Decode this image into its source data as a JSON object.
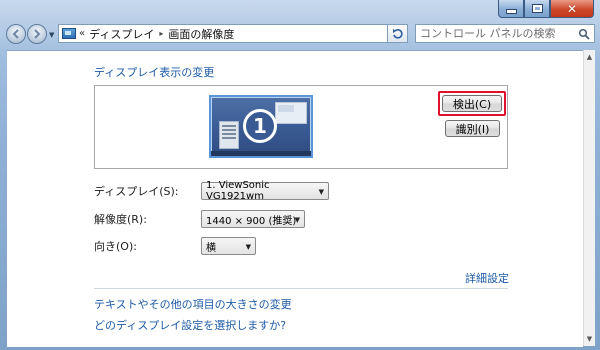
{
  "window": {
    "caption": {
      "minimize_icon": "minimize-icon",
      "maximize_icon": "maximize-icon",
      "close_glyph": "✕"
    }
  },
  "nav": {
    "back_icon": "back-arrow-icon",
    "forward_icon": "forward-arrow-icon"
  },
  "address": {
    "chevron": "«",
    "segments": [
      "ディスプレイ",
      "画面の解像度"
    ],
    "separator": "▸"
  },
  "search": {
    "placeholder": "コントロール パネルの検索"
  },
  "content": {
    "heading": "ディスプレイ表示の変更",
    "monitor_number": "1",
    "detect_label": "検出(C)",
    "identify_label": "識別(I)",
    "display_label": "ディスプレイ(S):",
    "display_value": "1. ViewSonic VG1921wm",
    "resolution_label": "解像度(R):",
    "resolution_value": "1440 × 900 (推奨)",
    "orientation_label": "向き(O):",
    "orientation_value": "横",
    "advanced_link": "詳細設定",
    "text_size_link": "テキストやその他の項目の大きさの変更",
    "which_settings_link": "どのディスプレイ設定を選択しますか?"
  },
  "colors": {
    "link": "#1e5ba8",
    "highlight": "#e0112d",
    "monitor_bg": "#3a5a93"
  }
}
